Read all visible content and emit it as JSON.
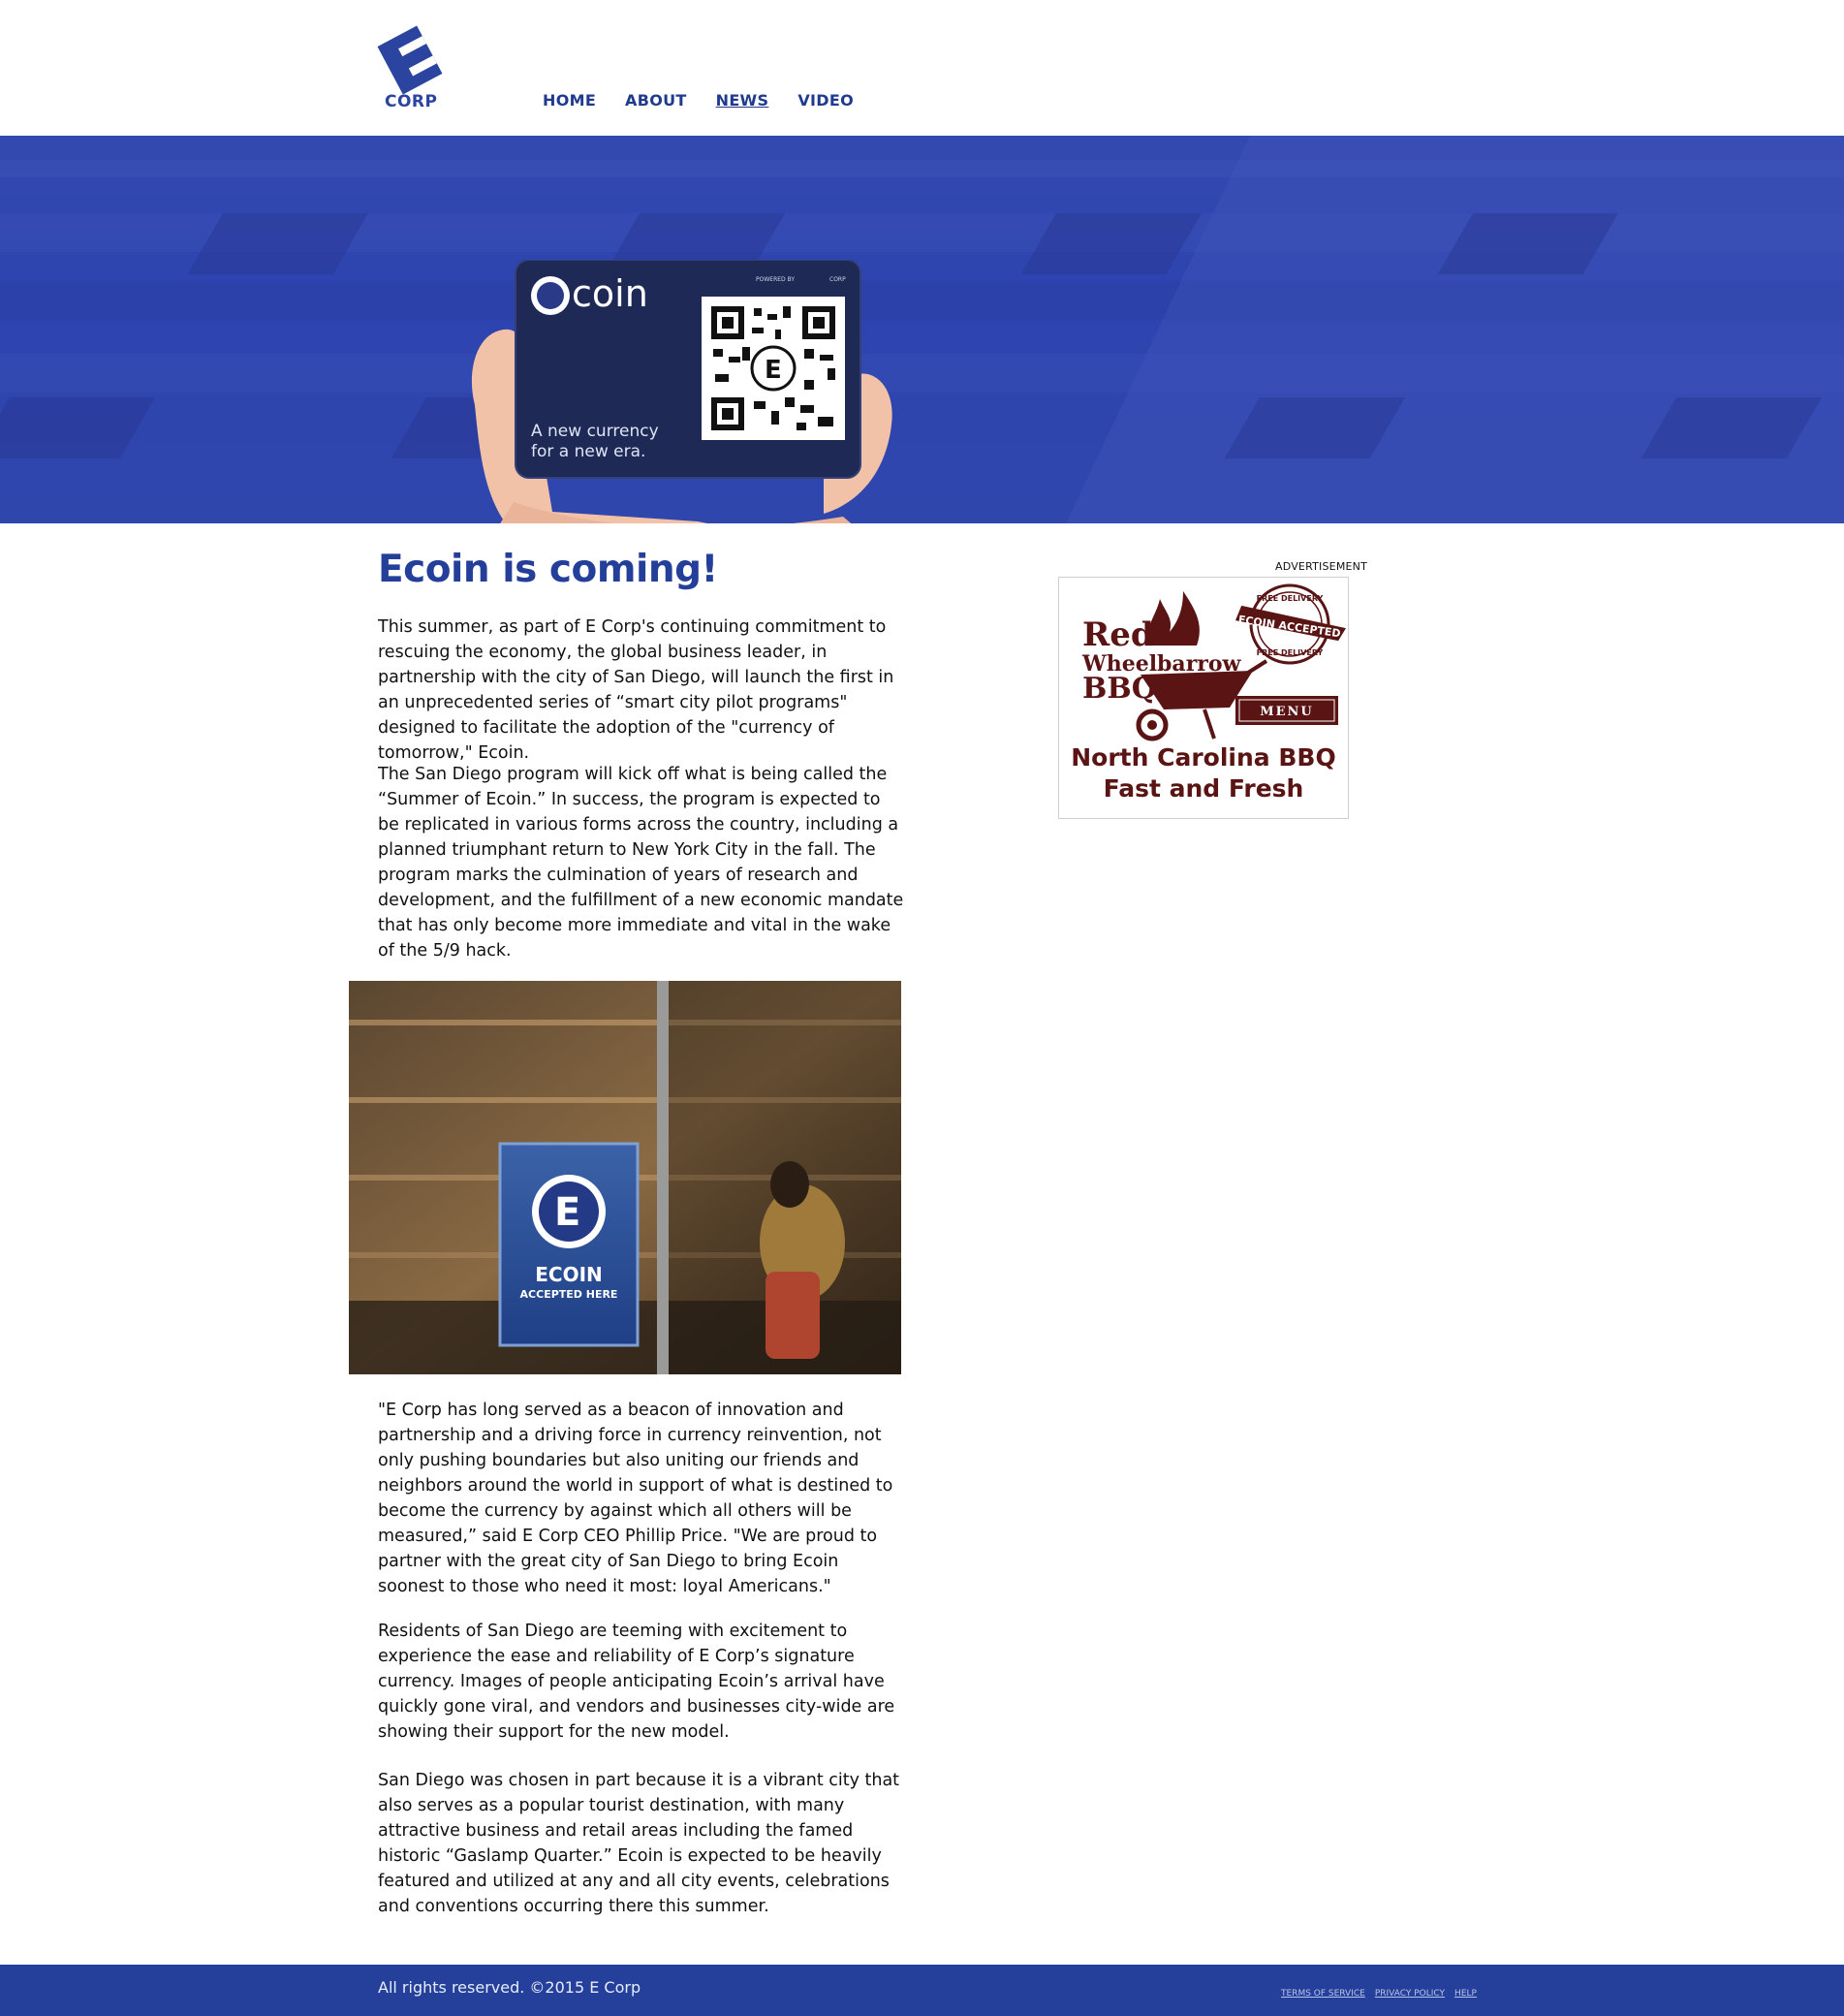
{
  "header": {
    "logo_text": "CORP",
    "nav": [
      {
        "label": "HOME"
      },
      {
        "label": "ABOUT"
      },
      {
        "label": "NEWS",
        "active": true
      },
      {
        "label": "VIDEO"
      }
    ]
  },
  "hero": {
    "card_brand": "coin",
    "card_powered": "POWERED BY",
    "card_powered_brand": "CORP",
    "card_tagline_1": "A new currency",
    "card_tagline_2": "for a new era."
  },
  "article": {
    "title": "Ecoin is coming!",
    "paragraphs": [
      "This summer, as part of E Corp's continuing commitment to rescuing the economy, the global business leader, in partnership with the city of San Diego, will launch the first in an unprecedented series of “smart city pilot programs\" designed to facilitate the adoption of the \"currency of tomorrow,\" Ecoin.",
      "The San Diego program will kick off what is being called the “Summer of Ecoin.” In success, the program is expected to be replicated in various forms across the country, including a planned triumphant return to New York City in the fall. The program marks the culmination of years of research and development, and the fulfillment of a new economic mandate that has only become more immediate and vital in the wake of the 5/9 hack.",
      "\"E Corp has long served as a beacon of innovation and partnership and a driving force in currency reinvention, not only pushing boundaries but also uniting our friends and neighbors around the world in support of what is destined to become the currency by against which all others will be measured,” said E Corp CEO Phillip Price. \"We are proud to partner with the great city of San Diego to bring Ecoin soonest to those who need it most: loyal Americans.\"",
      "Residents of San Diego are teeming with excitement to experience the ease and reliability of E Corp’s signature currency. Images of people anticipating Ecoin’s arrival have quickly gone viral, and vendors and businesses city-wide are showing their support for the new model.",
      "San Diego was chosen in part because it is a vibrant city that also serves as a popular tourist destination, with many attractive business and retail areas including the famed historic “Gaslamp Quarter.” Ecoin is expected to be heavily featured and utilized at any and all city events, celebrations and conventions occurring there this summer."
    ],
    "photo_sign_title": "ECOIN",
    "photo_sign_sub": "ACCEPTED HERE"
  },
  "ad": {
    "label": "ADVERTISEMENT",
    "name_1": "Red",
    "name_2": "Wheelbarrow",
    "name_3": "BBQ",
    "badge_top": "FREE DELIVERY",
    "badge_ribbon": "ECOIN ACCEPTED",
    "badge_bottom": "FREE DELIVERY",
    "menu": "MENU",
    "tagline_1": "North Carolina BBQ",
    "tagline_2": "Fast and Fresh"
  },
  "footer": {
    "copyright": "All rights reserved. ©2015 E Corp",
    "links": [
      "TERMS OF SERVICE",
      "PRIVACY POLICY",
      "HELP"
    ]
  },
  "colors": {
    "brand_blue": "#233f99",
    "footer_blue": "#25409a",
    "bbq_maroon": "#5a1414"
  }
}
